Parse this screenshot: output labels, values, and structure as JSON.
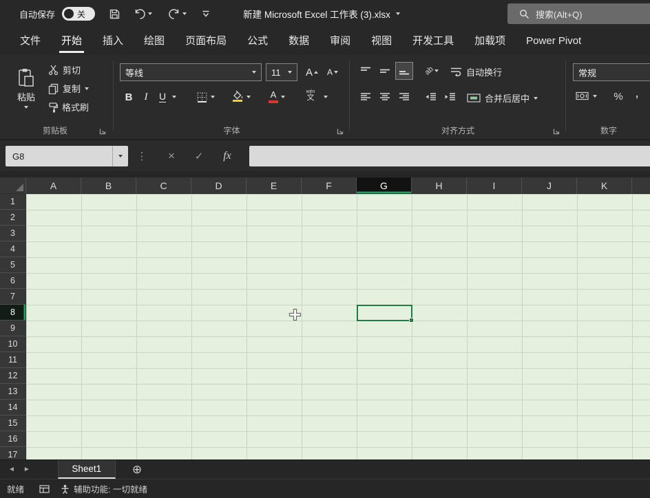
{
  "titlebar": {
    "autosave_label": "自动保存",
    "autosave_state": "关",
    "title": "新建 Microsoft Excel 工作表 (3).xlsx",
    "search_placeholder": "搜索(Alt+Q)"
  },
  "ribbon_tabs": [
    "文件",
    "开始",
    "插入",
    "绘图",
    "页面布局",
    "公式",
    "数据",
    "审阅",
    "视图",
    "开发工具",
    "加载项",
    "Power Pivot"
  ],
  "active_tab": "开始",
  "clipboard": {
    "group_label": "剪贴板",
    "paste": "粘贴",
    "cut": "剪切",
    "copy": "复制",
    "format_painter": "格式刷"
  },
  "font": {
    "group_label": "字体",
    "font_name": "等线",
    "font_size": "11",
    "bold": "B",
    "italic": "I",
    "underline": "U",
    "grow_font": "A",
    "shrink_font": "A",
    "phonetic_small": "wén",
    "phonetic_main": "文"
  },
  "alignment": {
    "group_label": "对齐方式",
    "orientation_glyph": "ab",
    "wrap_text": "自动换行",
    "merge_center": "合并后居中"
  },
  "number": {
    "group_label": "数字",
    "format": "常规",
    "percent": "%",
    "comma": ","
  },
  "formula_bar": {
    "name_box": "G8",
    "more": "⋮",
    "cancel": "×",
    "enter": "✓",
    "fx": "fx"
  },
  "grid": {
    "columns": [
      "A",
      "B",
      "C",
      "D",
      "E",
      "F",
      "G",
      "H",
      "I",
      "J",
      "K"
    ],
    "rows": [
      "1",
      "2",
      "3",
      "4",
      "5",
      "6",
      "7",
      "8",
      "9",
      "10",
      "11",
      "12",
      "13",
      "14",
      "15",
      "16",
      "17"
    ],
    "selected_cell": "G8"
  },
  "sheet_bar": {
    "prev": "◄",
    "next": "►",
    "active_sheet": "Sheet1",
    "add": "⊕"
  },
  "status_bar": {
    "ready": "就绪",
    "accessibility": "辅助功能: 一切就绪"
  },
  "colors": {
    "accent_green": "#1E7C46",
    "header_accent": "#21A05B",
    "fill_yellow": "#F2CE30",
    "font_red": "#D8392C",
    "cell_bg": "#E5F0DF"
  }
}
